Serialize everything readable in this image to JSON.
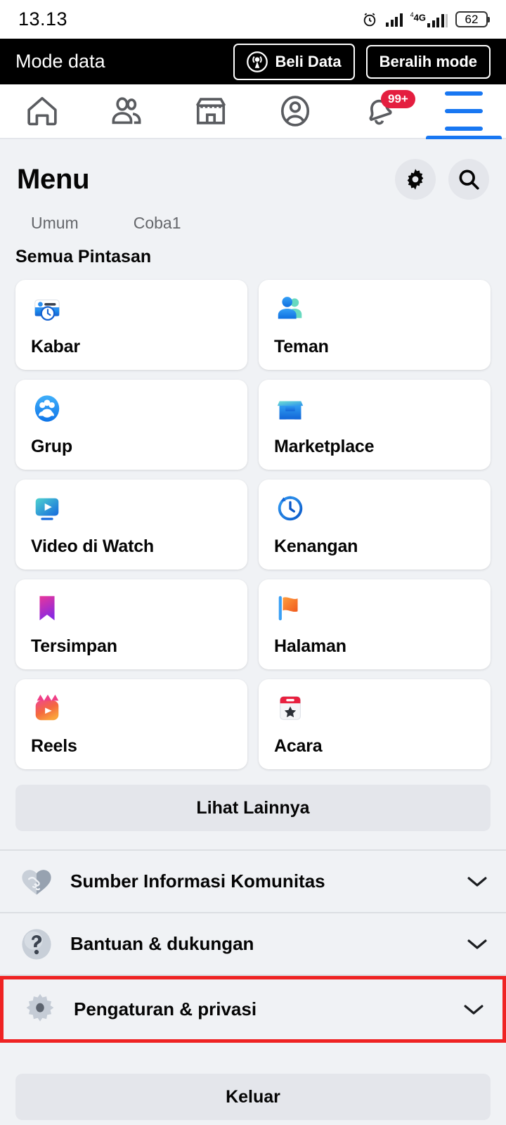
{
  "status_bar": {
    "time": "13.13",
    "alarm_icon": "alarm-clock-icon",
    "signal_icon": "signal-bars-icon",
    "network_label": "4G",
    "network_prefix": "4",
    "battery_level": "62"
  },
  "data_mode_bar": {
    "title": "Mode data",
    "buy_data_label": "Beli Data",
    "buy_data_icon": "broadcast-icon",
    "switch_mode_label": "Beralih mode"
  },
  "nav_tabs": [
    {
      "name": "home",
      "icon": "home-icon",
      "active": false,
      "badge": ""
    },
    {
      "name": "friends",
      "icon": "friends-icon",
      "active": false,
      "badge": ""
    },
    {
      "name": "marketplace",
      "icon": "marketplace-icon",
      "active": false,
      "badge": ""
    },
    {
      "name": "profile",
      "icon": "profile-icon",
      "active": false,
      "badge": ""
    },
    {
      "name": "notifications",
      "icon": "bell-icon",
      "active": false,
      "badge": "99+"
    },
    {
      "name": "menu",
      "icon": "hamburger-menu-icon",
      "active": true,
      "badge": ""
    }
  ],
  "header": {
    "title": "Menu",
    "settings_icon": "gear-icon",
    "search_icon": "search-icon"
  },
  "sub_tabs": [
    {
      "label": "Umum"
    },
    {
      "label": "Coba1"
    }
  ],
  "shortcuts_section": {
    "title": "Semua Pintasan",
    "items": [
      {
        "label": "Kabar",
        "icon": "news-feed-icon"
      },
      {
        "label": "Teman",
        "icon": "friends-color-icon"
      },
      {
        "label": "Grup",
        "icon": "groups-icon"
      },
      {
        "label": "Marketplace",
        "icon": "marketplace-color-icon"
      },
      {
        "label": "Video di Watch",
        "icon": "watch-video-icon"
      },
      {
        "label": "Kenangan",
        "icon": "memories-clock-icon"
      },
      {
        "label": "Tersimpan",
        "icon": "saved-bookmark-icon"
      },
      {
        "label": "Halaman",
        "icon": "pages-flag-icon"
      },
      {
        "label": "Reels",
        "icon": "reels-icon"
      },
      {
        "label": "Acara",
        "icon": "events-calendar-icon"
      }
    ],
    "see_more_label": "Lihat Lainnya"
  },
  "accordion_rows": [
    {
      "label": "Sumber Informasi Komunitas",
      "icon": "handshake-heart-icon",
      "chevron": "chevron-down-icon",
      "highlighted": false
    },
    {
      "label": "Bantuan & dukungan",
      "icon": "question-mark-icon",
      "chevron": "chevron-down-icon",
      "highlighted": false
    },
    {
      "label": "Pengaturan & privasi",
      "icon": "settings-gear-icon",
      "chevron": "chevron-down-icon",
      "highlighted": true
    }
  ],
  "logout": {
    "label": "Keluar"
  },
  "colors": {
    "page_bg": "#f0f2f5",
    "card_bg": "#ffffff",
    "accent_blue": "#1877f2",
    "badge_red": "#e41e3f",
    "highlight_red": "#ef2323",
    "text_primary": "#050505",
    "text_secondary": "#65676b",
    "button_grey": "#e4e6eb"
  }
}
